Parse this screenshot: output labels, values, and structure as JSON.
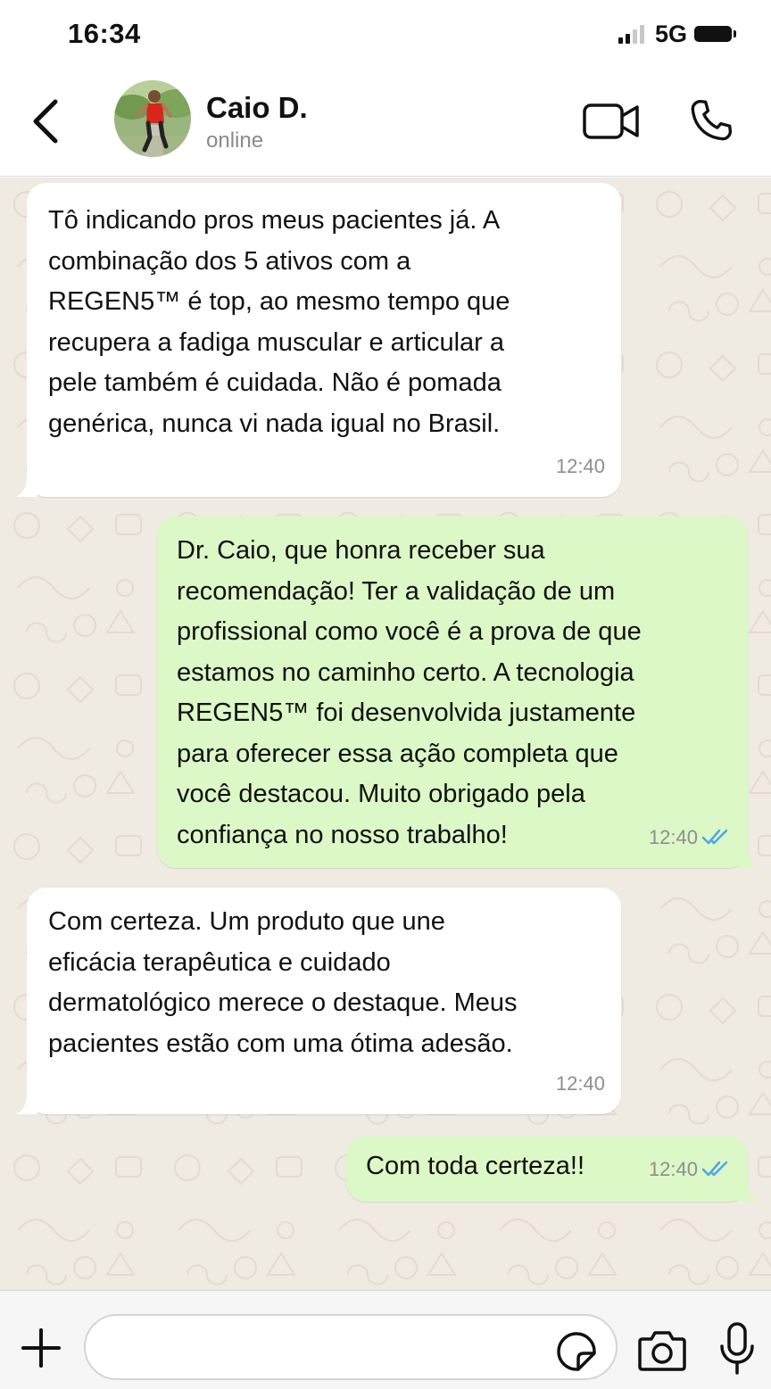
{
  "status_bar": {
    "time": "16:34",
    "network": "5G"
  },
  "header": {
    "contact_name": "Caio D.",
    "contact_status": "online"
  },
  "messages": [
    {
      "direction": "incoming",
      "text": "Tô indicando pros meus pacientes já. A\ncombinação dos 5 ativos com a\nREGEN5™ é top, ao mesmo tempo que\nrecupera a fadiga muscular e articular a\npele também é cuidada. Não é pomada\ngenérica, nunca vi nada igual no Brasil.",
      "time": "12:40"
    },
    {
      "direction": "outgoing",
      "text": "Dr. Caio, que honra receber sua\nrecomendação! Ter a validação de um\nprofissional como você é a prova de que\nestamos no caminho certo. A tecnologia\nREGEN5™ foi desenvolvida justamente\npara oferecer essa ação completa que\nvocê destacou. Muito obrigado pela\nconfiança no nosso trabalho!",
      "time": "12:40",
      "read": true
    },
    {
      "direction": "incoming",
      "text": "Com certeza. Um produto que une\neficácia terapêutica e cuidado\ndermatológico merece o destaque. Meus\npacientes estão com uma ótima adesão.",
      "time": "12:40"
    },
    {
      "direction": "outgoing",
      "text": "Com toda certeza!!",
      "time": "12:40",
      "read": true
    }
  ],
  "input": {
    "value": "",
    "placeholder": ""
  },
  "icons": {
    "back": "chevron-left-icon",
    "video": "video-camera-icon",
    "call": "phone-icon",
    "attach": "plus-icon",
    "sticker": "sticker-icon",
    "camera": "camera-icon",
    "mic": "microphone-icon"
  },
  "colors": {
    "chat_background": "#efeae2",
    "incoming_bubble": "#ffffff",
    "outgoing_bubble": "#dcf8c6",
    "read_ticks": "#4fa6e8",
    "meta_text": "#8e8e8e"
  }
}
